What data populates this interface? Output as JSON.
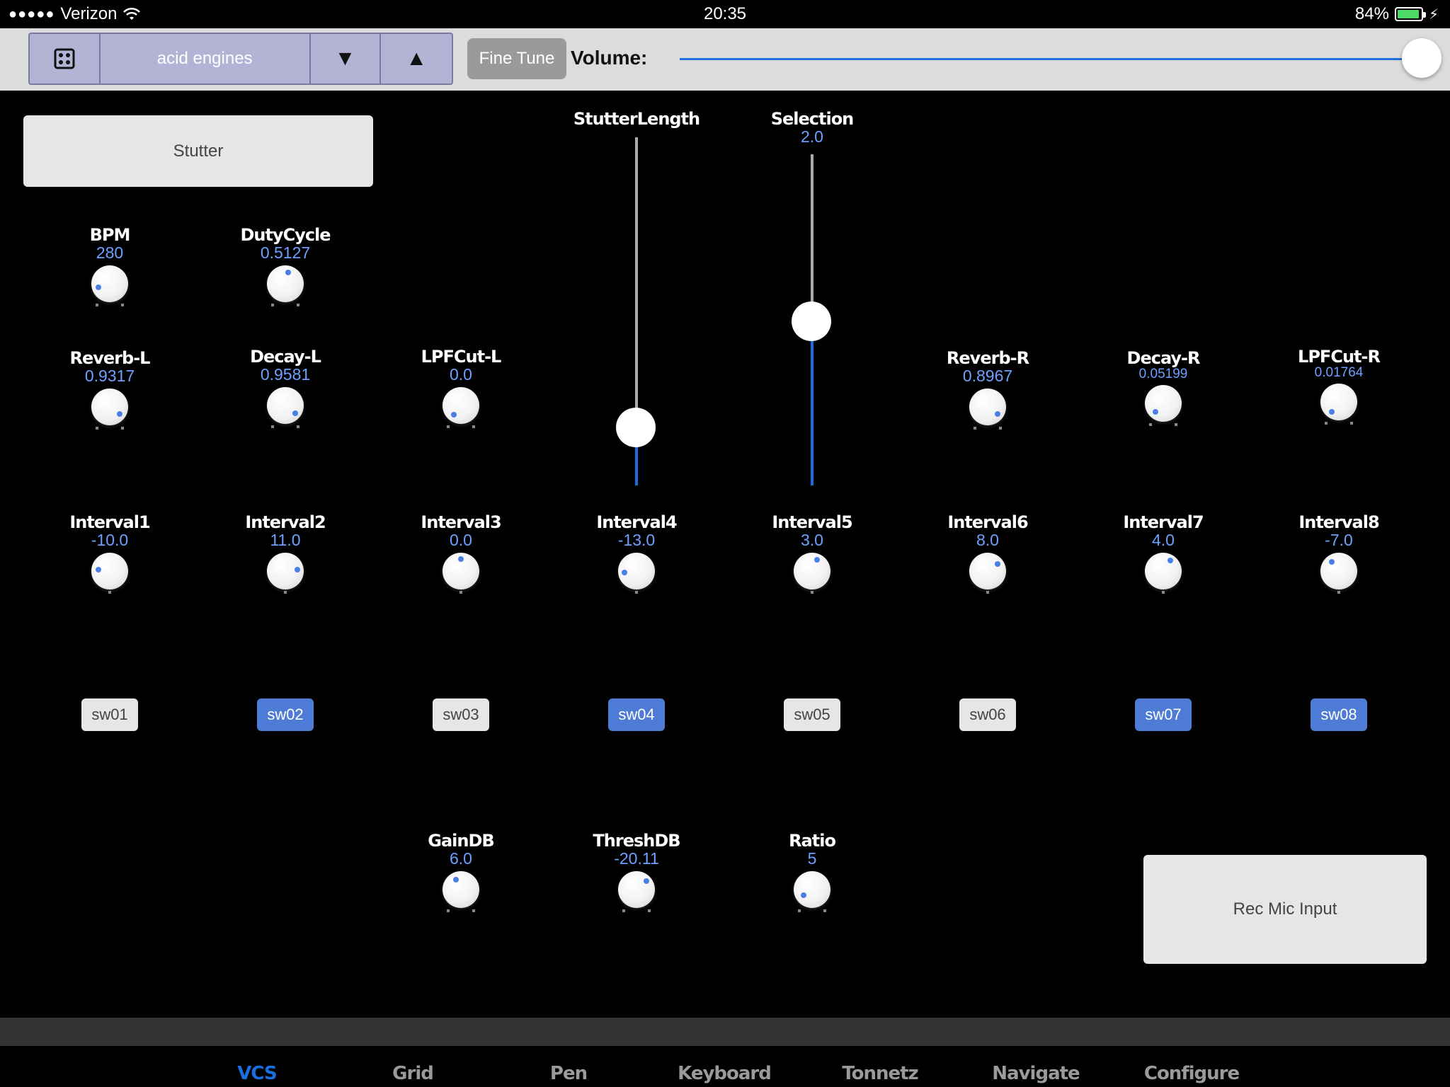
{
  "status": {
    "signal": "●●●●●",
    "carrier": "Verizon",
    "time": "20:35",
    "battery": "84%"
  },
  "toolbar": {
    "preset": "acid engines",
    "down": "▼",
    "up": "▲",
    "fine_tune": "Fine Tune",
    "volume_label": "Volume:",
    "volume_level": 1.0
  },
  "buttons": {
    "stutter": "Stutter",
    "rec": "Rec Mic Input"
  },
  "knobs": {
    "bpm": {
      "name": "BPM",
      "value": "280"
    },
    "duty": {
      "name": "DutyCycle",
      "value": "0.5127"
    },
    "reverb_l": {
      "name": "Reverb-L",
      "value": "0.9317"
    },
    "decay_l": {
      "name": "Decay-L",
      "value": "0.9581"
    },
    "lpf_l": {
      "name": "LPFCut-L",
      "value": "0.0"
    },
    "reverb_r": {
      "name": "Reverb-R",
      "value": "0.8967"
    },
    "decay_r": {
      "name": "Decay-R",
      "value": "0.05199"
    },
    "lpf_r": {
      "name": "LPFCut-R",
      "value": "0.01764"
    },
    "int1": {
      "name": "Interval1",
      "value": "-10.0"
    },
    "int2": {
      "name": "Interval2",
      "value": "11.0"
    },
    "int3": {
      "name": "Interval3",
      "value": "0.0"
    },
    "int4": {
      "name": "Interval4",
      "value": "-13.0"
    },
    "int5": {
      "name": "Interval5",
      "value": "3.0"
    },
    "int6": {
      "name": "Interval6",
      "value": "8.0"
    },
    "int7": {
      "name": "Interval7",
      "value": "4.0"
    },
    "int8": {
      "name": "Interval8",
      "value": "-7.0"
    },
    "gain": {
      "name": "GainDB",
      "value": "6.0"
    },
    "thresh": {
      "name": "ThreshDB",
      "value": "-20.11"
    },
    "ratio": {
      "name": "Ratio",
      "value": "5"
    }
  },
  "sliders": {
    "stutter_length": {
      "name": "StutterLength",
      "value": "",
      "level": 0.17
    },
    "selection": {
      "name": "Selection",
      "value": "2.0",
      "level": 0.5
    }
  },
  "switches": {
    "sw01": {
      "label": "sw01",
      "on": false
    },
    "sw02": {
      "label": "sw02",
      "on": true
    },
    "sw03": {
      "label": "sw03",
      "on": false
    },
    "sw04": {
      "label": "sw04",
      "on": true
    },
    "sw05": {
      "label": "sw05",
      "on": false
    },
    "sw06": {
      "label": "sw06",
      "on": false
    },
    "sw07": {
      "label": "sw07",
      "on": true
    },
    "sw08": {
      "label": "sw08",
      "on": true
    }
  },
  "tabs": [
    "VCS",
    "Grid",
    "Pen",
    "Keyboard",
    "Tonnetz",
    "Navigate",
    "Configure"
  ],
  "active_tab": "VCS",
  "colors": {
    "accent": "#1a6fe0",
    "value_text": "#6ea0ff",
    "switch_on": "#4d7bd6",
    "switch_off": "#e6e6e6",
    "segment_bg": "#b3b3d6"
  }
}
